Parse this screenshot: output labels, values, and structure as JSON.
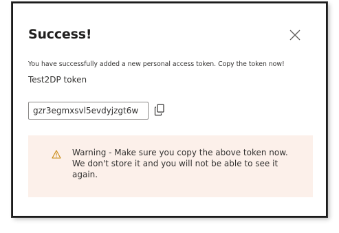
{
  "dialog": {
    "title": "Success!",
    "close_icon": "close-icon",
    "message": "You have successfully added a new personal access token. Copy the token now!",
    "token_name": "Test2DP token",
    "token_value": "gzr3egmxsvl5evdyjzgt6w",
    "copy_icon": "copy-icon",
    "warning": {
      "icon": "warning-icon",
      "text": "Warning - Make sure you copy the above token now. We don't store it and you will not be able to see it again.",
      "background_color": "#fcf0ea",
      "icon_color": "#c8870d"
    }
  }
}
